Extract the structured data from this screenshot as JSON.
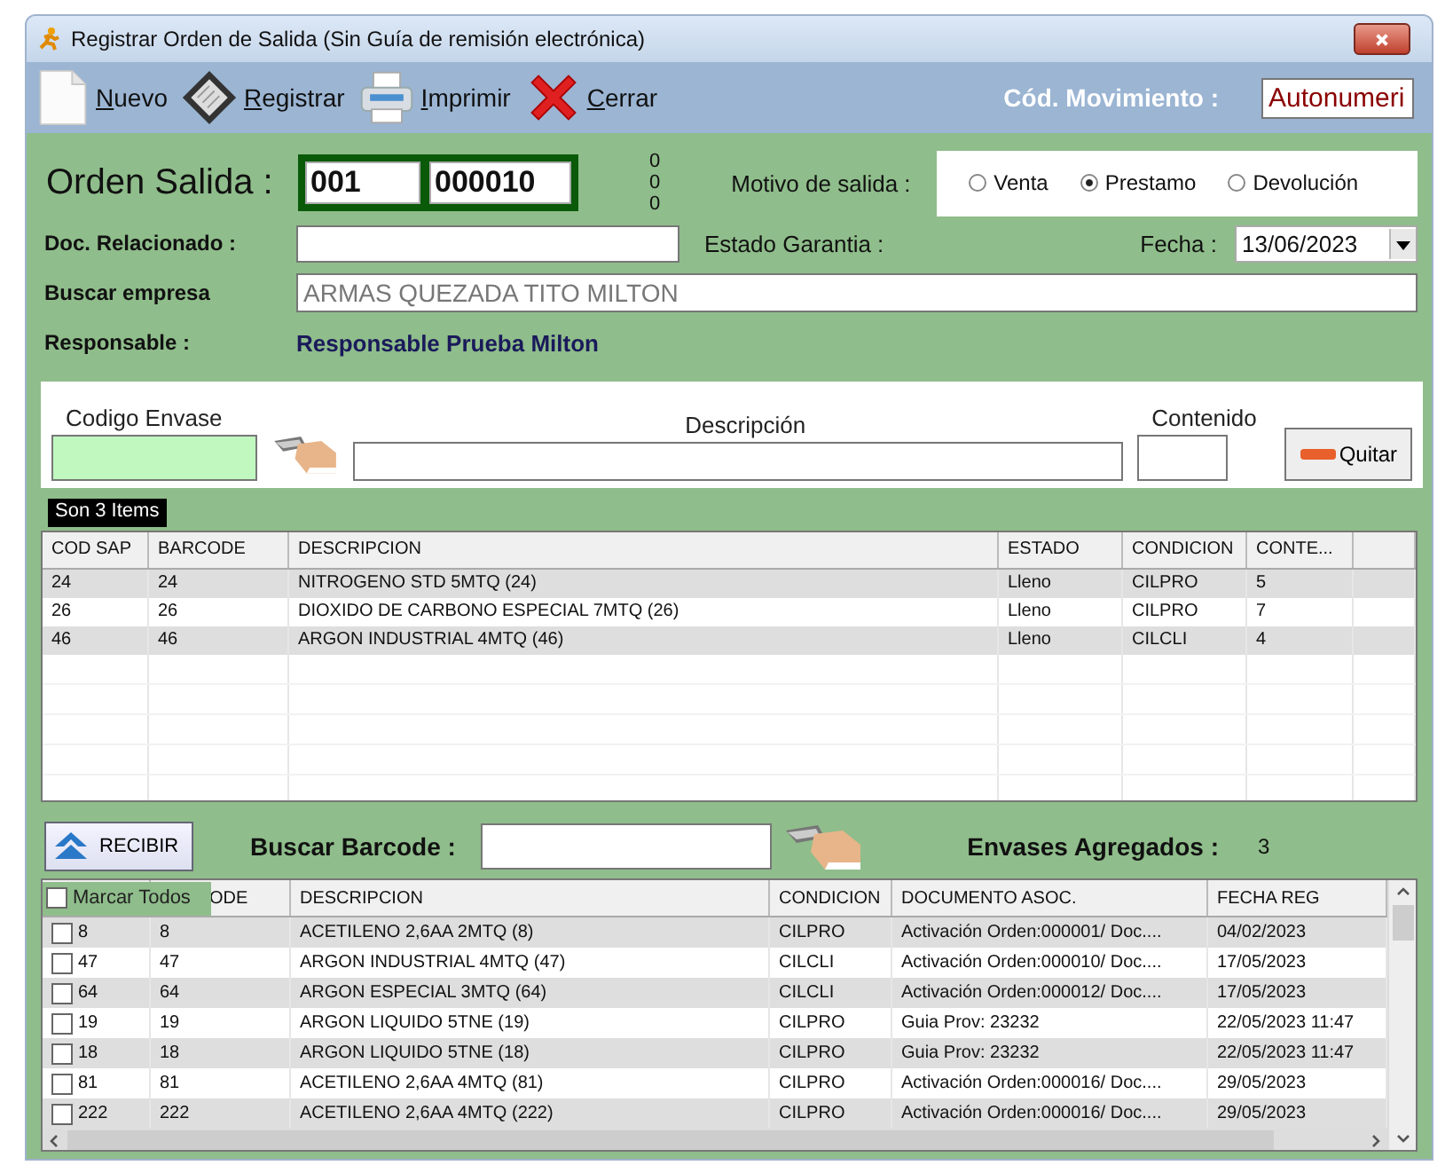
{
  "window": {
    "title": "Registrar Orden de Salida (Sin Guía de remisión electrónica)"
  },
  "toolbar": {
    "buttons": [
      {
        "kind": "new",
        "label": "Nuevo"
      },
      {
        "kind": "save",
        "label": "Registrar"
      },
      {
        "kind": "print",
        "label": "Imprimir"
      },
      {
        "kind": "close",
        "label": "Cerrar"
      }
    ],
    "movement_code_label": "Cód. Movimiento :",
    "movement_code": "Autonumeri"
  },
  "header": {
    "order_label": "Orden Salida :",
    "series": "001",
    "number": "000010",
    "counters": [
      "0",
      "0",
      "0"
    ],
    "reason_label": "Motivo de salida :",
    "reasons": [
      {
        "label": "Venta",
        "selected": false
      },
      {
        "label": "Prestamo",
        "selected": true
      },
      {
        "label": "Devolución",
        "selected": false
      }
    ],
    "related_doc_label": "Doc. Relacionado :",
    "warranty_label": "Estado Garantia :",
    "date_label": "Fecha :",
    "date": "13/06/2023",
    "company_label": "Buscar empresa",
    "company": "ARMAS QUEZADA TITO MILTON",
    "responsible_label": "Responsable :",
    "responsible": "Responsable Prueba Milton"
  },
  "entry": {
    "code_label": "Codigo Envase",
    "description_label": "Descripción",
    "content_label": "Contenido",
    "remove_button": "Quitar"
  },
  "items_table": {
    "count_tab": "Son 3 Items",
    "columns": [
      "COD SAP",
      "BARCODE",
      "DESCRIPCION",
      "ESTADO",
      "CONDICION",
      "CONTE..."
    ],
    "rows": [
      [
        "24",
        "24",
        "NITROGENO STD 5MTQ (24)",
        "Lleno",
        "CILPRO",
        "5"
      ],
      [
        "26",
        "26",
        "DIOXIDO DE CARBONO ESPECIAL 7MTQ (26)",
        "Lleno",
        "CILPRO",
        "7"
      ],
      [
        "46",
        "46",
        "ARGON INDUSTRIAL 4MTQ (46)",
        "Lleno",
        "CILCLI",
        "4"
      ]
    ]
  },
  "receive": {
    "button": "RECIBIR",
    "search_label": "Buscar Barcode :",
    "added_label": "Envases Agregados :",
    "added_count": "3"
  },
  "containers_table": {
    "columns": [
      {
        "kind": "select_all",
        "label": "Marcar Todos",
        "checked": false
      },
      {
        "kind": "text",
        "label": "ODE"
      },
      {
        "kind": "text",
        "label": "DESCRIPCION"
      },
      {
        "kind": "text",
        "label": "CONDICION"
      },
      {
        "kind": "text",
        "label": "DOCUMENTO ASOC."
      },
      {
        "kind": "text",
        "label": "FECHA REG"
      }
    ],
    "rows": [
      {
        "checked": false,
        "cells": [
          "8",
          "8",
          "ACETILENO 2,6AA 2MTQ (8)",
          "CILPRO",
          "Activación Orden:000001/ Doc....",
          "04/02/2023"
        ]
      },
      {
        "checked": false,
        "cells": [
          "47",
          "47",
          "ARGON INDUSTRIAL 4MTQ (47)",
          "CILCLI",
          "Activación Orden:000010/ Doc....",
          "17/05/2023"
        ]
      },
      {
        "checked": false,
        "cells": [
          "64",
          "64",
          "ARGON ESPECIAL 3MTQ (64)",
          "CILCLI",
          "Activación Orden:000012/ Doc....",
          "17/05/2023"
        ]
      },
      {
        "checked": false,
        "cells": [
          "19",
          "19",
          "ARGON LIQUIDO 5TNE (19)",
          "CILPRO",
          "Guia Prov: 23232",
          "22/05/2023 11:47"
        ]
      },
      {
        "checked": false,
        "cells": [
          "18",
          "18",
          "ARGON LIQUIDO 5TNE (18)",
          "CILPRO",
          "Guia Prov: 23232",
          "22/05/2023 11:47"
        ]
      },
      {
        "checked": false,
        "cells": [
          "81",
          "81",
          "ACETILENO 2,6AA 4MTQ (81)",
          "CILPRO",
          "Activación Orden:000016/ Doc....",
          "29/05/2023"
        ]
      },
      {
        "checked": false,
        "cells": [
          "222",
          "222",
          "ACETILENO 2,6AA 4MTQ (222)",
          "CILPRO",
          "Activación Orden:000016/ Doc....",
          "29/05/2023"
        ]
      }
    ]
  }
}
